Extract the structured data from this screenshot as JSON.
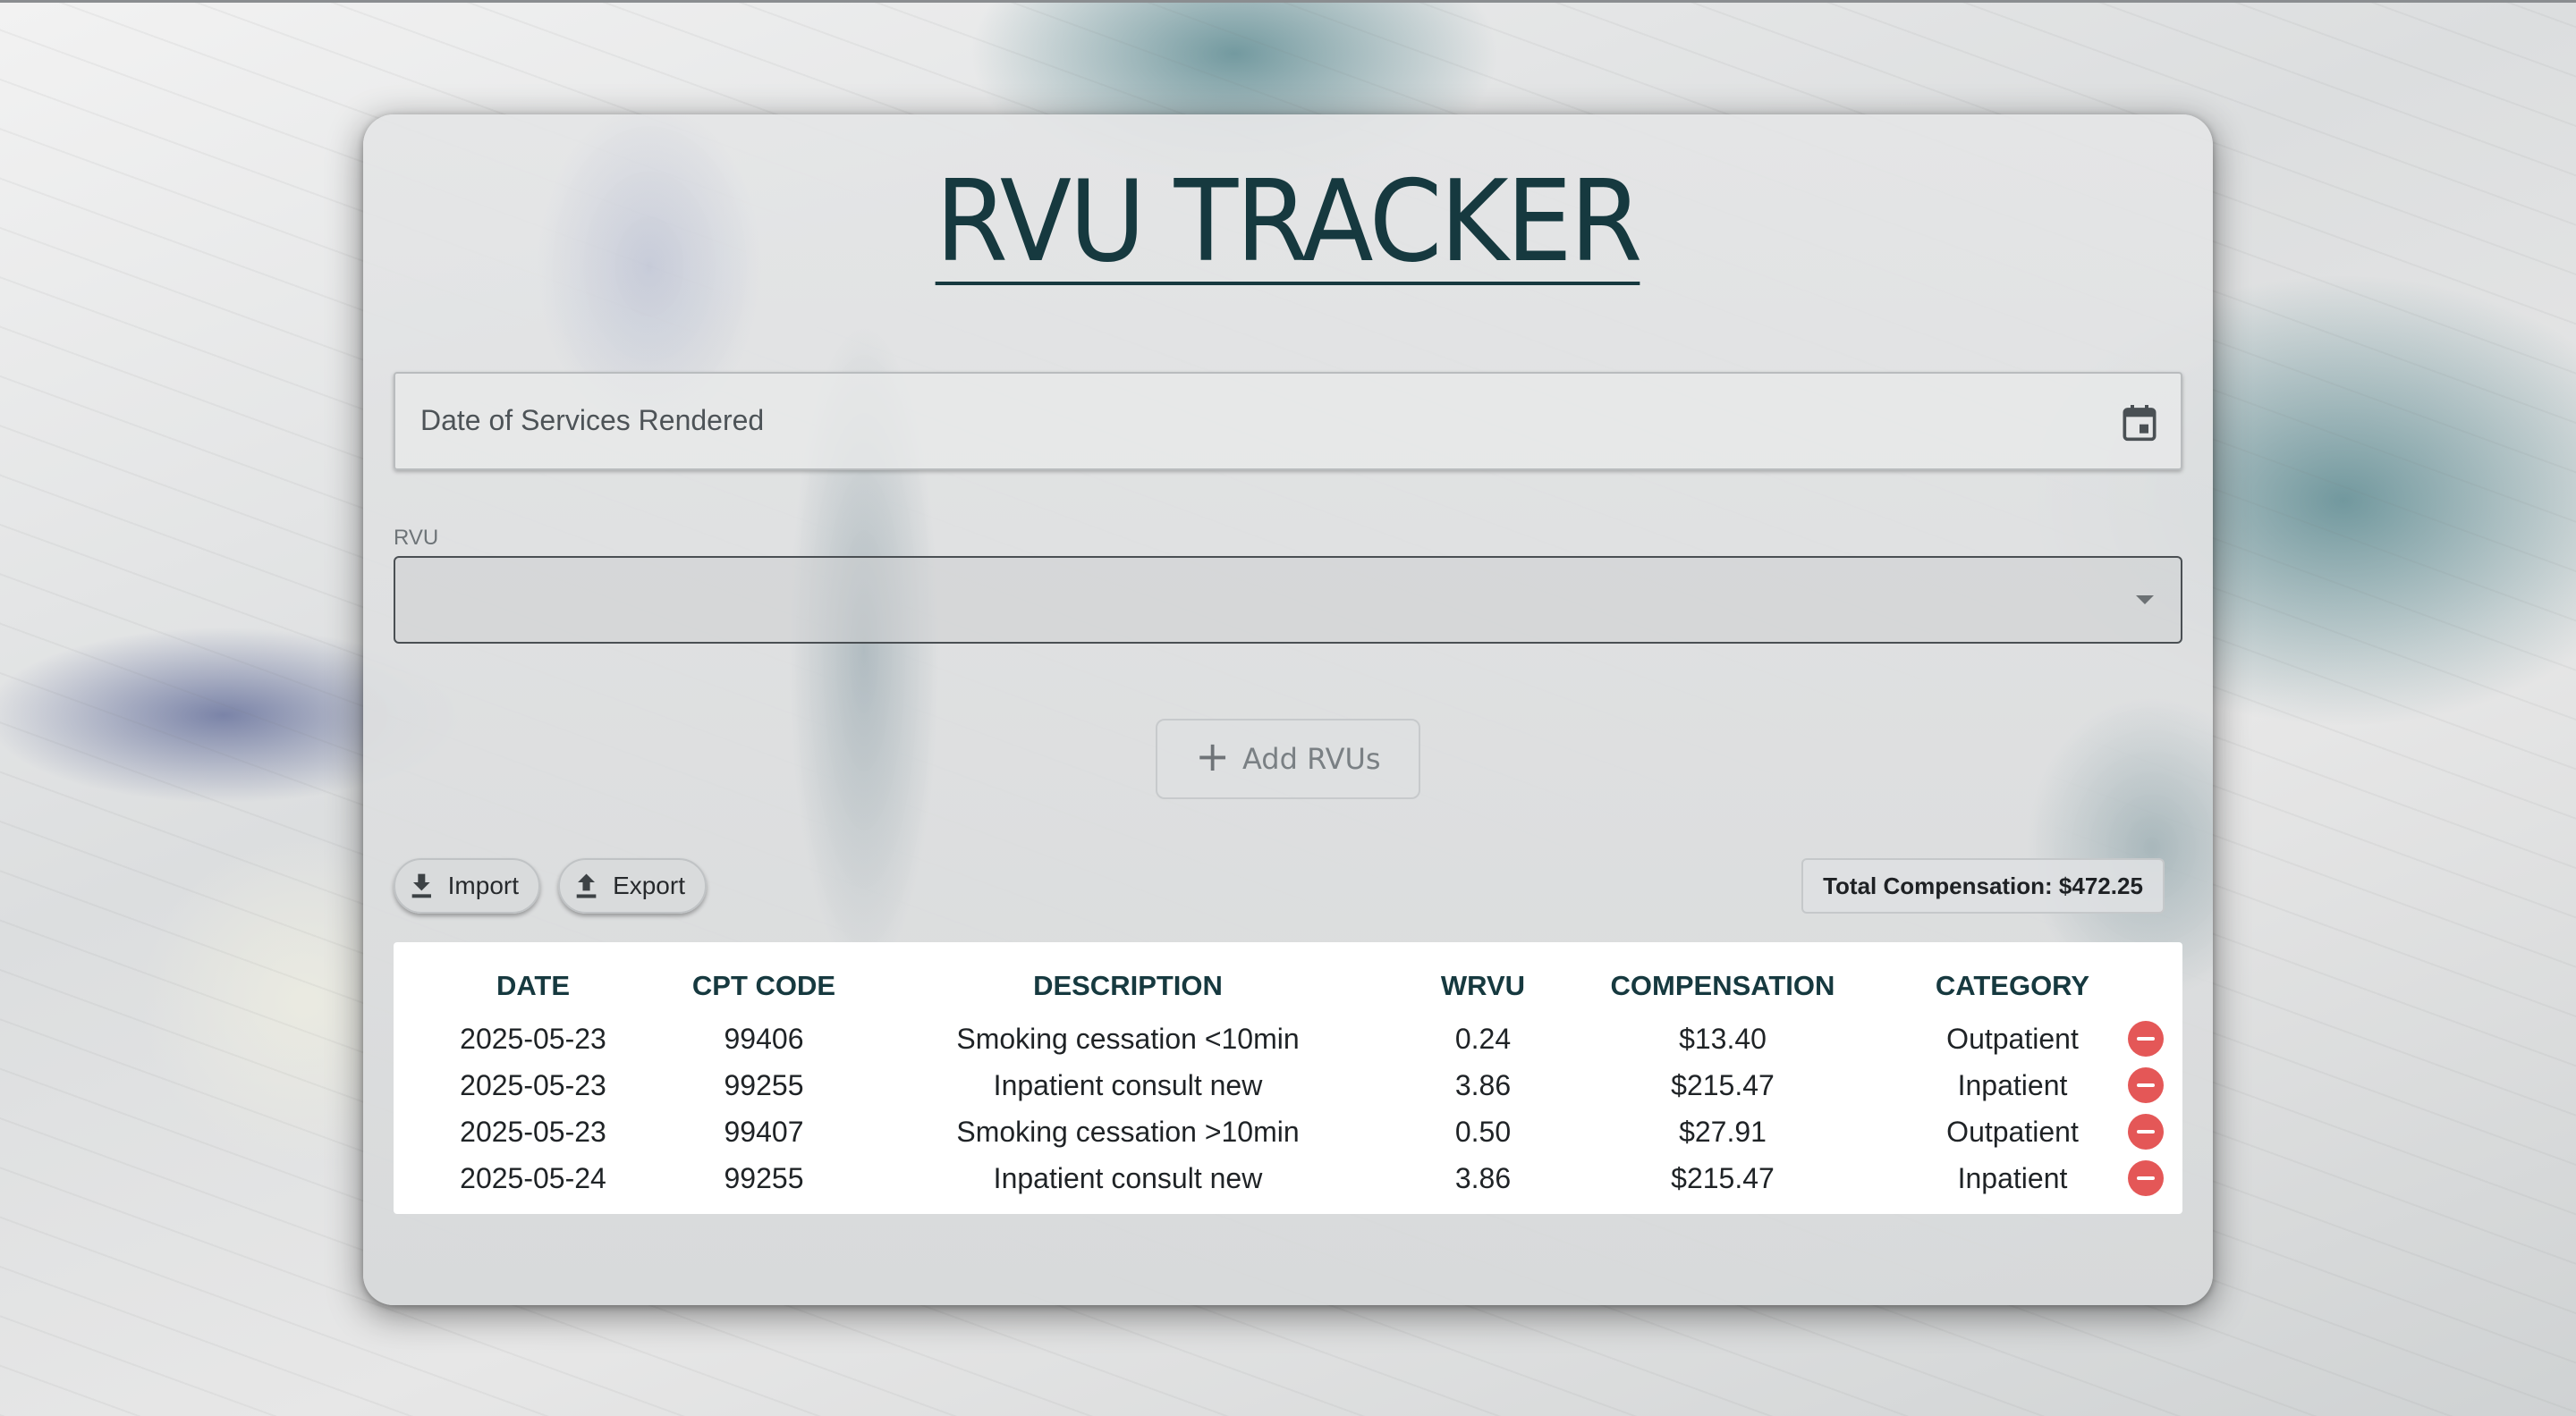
{
  "app": {
    "title": "RVU TRACKER"
  },
  "form": {
    "date_placeholder": "Date of Services Rendered",
    "rvu_label": "RVU",
    "rvu_value": "",
    "add_button_label": "Add RVUs"
  },
  "toolbar": {
    "import_label": "Import",
    "export_label": "Export",
    "total_text": "Total Compensation: $472.25"
  },
  "table": {
    "headers": [
      "DATE",
      "CPT CODE",
      "DESCRIPTION",
      "WRVU",
      "COMPENSATION",
      "CATEGORY"
    ],
    "rows": [
      {
        "date": "2025-05-23",
        "cpt": "99406",
        "description": "Smoking cessation <10min",
        "wrvu": "0.24",
        "compensation": "$13.40",
        "category": "Outpatient"
      },
      {
        "date": "2025-05-23",
        "cpt": "99255",
        "description": "Inpatient consult new",
        "wrvu": "3.86",
        "compensation": "$215.47",
        "category": "Inpatient"
      },
      {
        "date": "2025-05-23",
        "cpt": "99407",
        "description": "Smoking cessation >10min",
        "wrvu": "0.50",
        "compensation": "$27.91",
        "category": "Outpatient"
      },
      {
        "date": "2025-05-24",
        "cpt": "99255",
        "description": "Inpatient consult new",
        "wrvu": "3.86",
        "compensation": "$215.47",
        "category": "Inpatient"
      }
    ]
  },
  "icons": {
    "calendar": "calendar-icon",
    "dropdown": "chevron-down-icon",
    "add": "plus-icon",
    "import": "download-icon",
    "export": "upload-icon",
    "delete": "remove-circle-icon"
  },
  "colors": {
    "title": "#16393f",
    "delete": "#e45757",
    "header_text": "#16393f"
  }
}
